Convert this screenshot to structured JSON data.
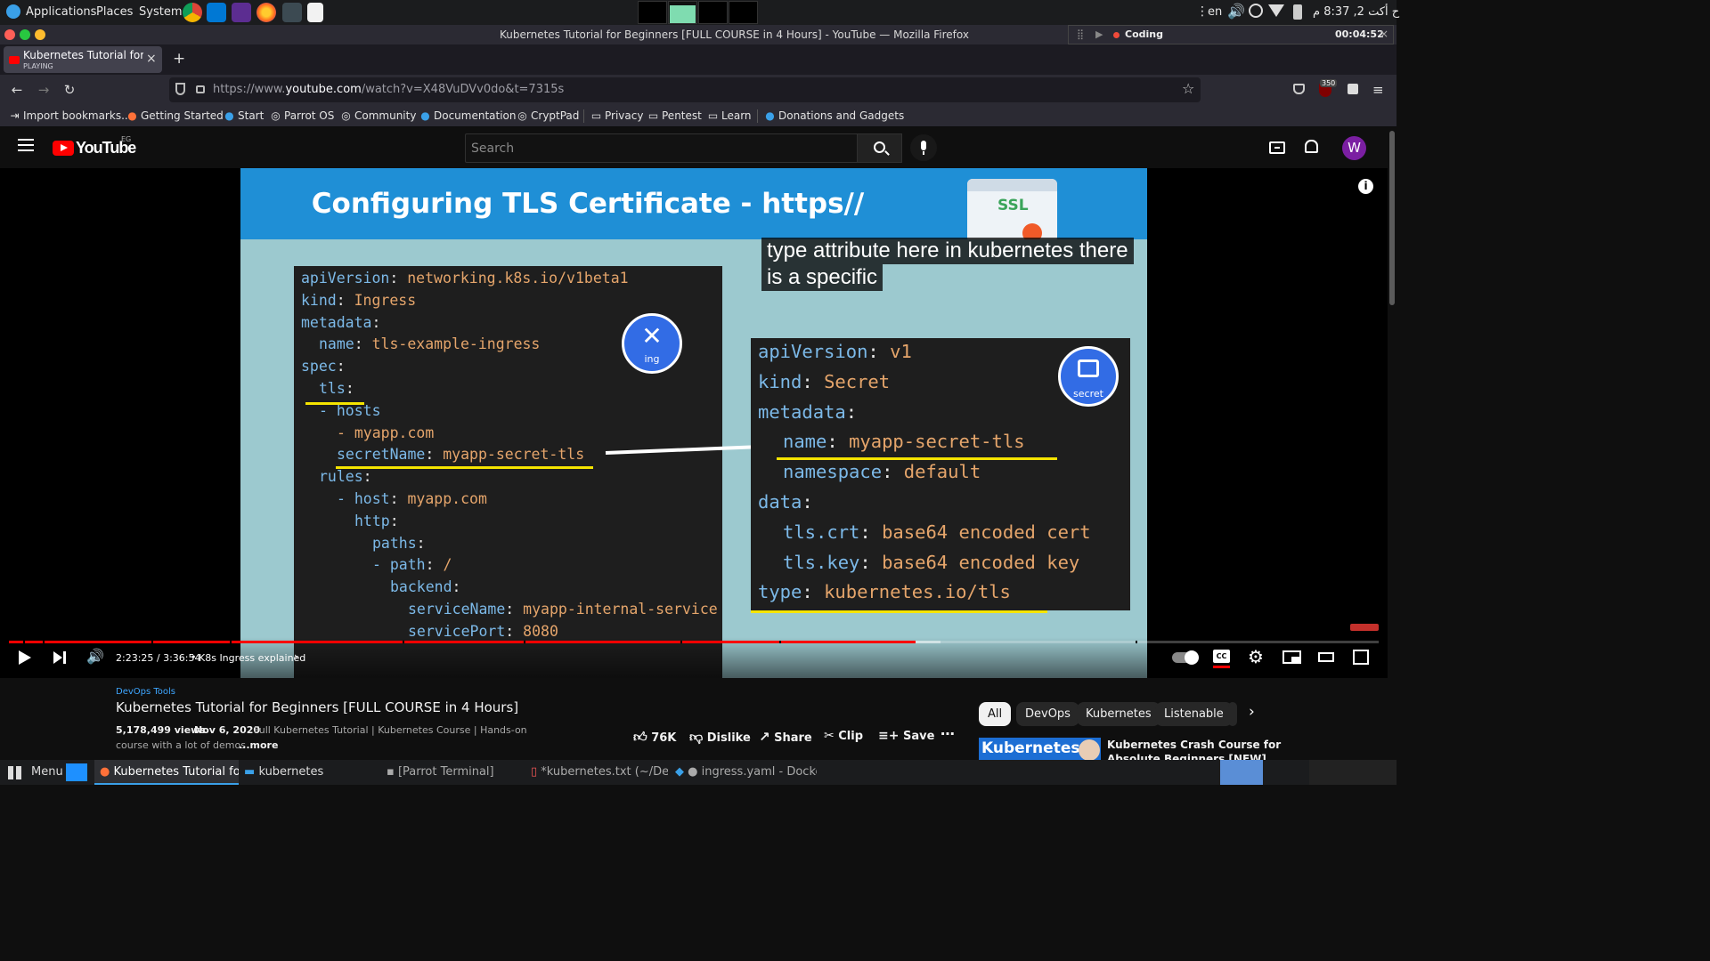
{
  "os_top": {
    "menus": [
      "Applications",
      "Places",
      "System"
    ],
    "keyboard_layout": "en",
    "clock": "ح أكت 2, 8:37 م"
  },
  "window": {
    "title": "Kubernetes Tutorial for Beginners [FULL COURSE in 4 Hours] - YouTube — Mozilla Firefox"
  },
  "media_widget": {
    "label": "Coding",
    "time": "00:04:52"
  },
  "tab": {
    "title": "Kubernetes Tutorial for B",
    "status": "PLAYING",
    "new_tab": "+"
  },
  "urlbar": {
    "prefix": "https://www.",
    "domain": "youtube.com",
    "path": "/watch?v=X48VuDVv0do&t=7315s"
  },
  "extensions": {
    "badge_count": "350"
  },
  "bookmarks": [
    {
      "label": "Import bookmarks...",
      "icon": "import-icon"
    },
    {
      "label": "Getting Started",
      "icon": "firefox-icon"
    },
    {
      "label": "Start",
      "icon": "parrot-icon"
    },
    {
      "label": "Parrot OS",
      "icon": "globe-icon"
    },
    {
      "label": "Community",
      "icon": "globe-icon"
    },
    {
      "label": "Documentation",
      "icon": "parrot-icon"
    },
    {
      "label": "CryptPad",
      "icon": "globe-icon"
    },
    {
      "label": "Privacy",
      "icon": "folder-icon"
    },
    {
      "label": "Pentest",
      "icon": "folder-icon"
    },
    {
      "label": "Learn",
      "icon": "folder-icon"
    },
    {
      "label": "Donations and Gadgets",
      "icon": "parrot-icon"
    }
  ],
  "youtube": {
    "logo_text": "YouTube",
    "region": "EG",
    "search_placeholder": "Search",
    "avatar_letter": "W"
  },
  "slide": {
    "title": "Configuring TLS Certificate - https//",
    "ssl_label": "SSL",
    "ing_label": "ing",
    "secret_label": "secret",
    "ingress_code": [
      {
        "k": "apiVersion",
        "v": "networking.k8s.io/v1beta1",
        "indent": 0
      },
      {
        "k": "kind",
        "v": "Ingress",
        "indent": 0
      },
      {
        "k": "metadata",
        "v": "",
        "indent": 0
      },
      {
        "k": "name",
        "v": "tls-example-ingress",
        "indent": 1
      },
      {
        "k": "spec",
        "v": "",
        "indent": 0
      },
      {
        "k": "tls",
        "v": "",
        "indent": 1
      },
      {
        "k": "- hosts",
        "v": "",
        "indent": 1
      },
      {
        "k": "",
        "v": "- myapp.com",
        "indent": 2
      },
      {
        "k": "secretName",
        "v": "myapp-secret-tls",
        "indent": 2
      },
      {
        "k": "rules",
        "v": "",
        "indent": 1
      },
      {
        "k": "- host",
        "v": "myapp.com",
        "indent": 2
      },
      {
        "k": "http",
        "v": "",
        "indent": 3
      },
      {
        "k": "paths",
        "v": "",
        "indent": 4
      },
      {
        "k": "- path",
        "v": "/",
        "indent": 4
      },
      {
        "k": "backend",
        "v": "",
        "indent": 5
      },
      {
        "k": "serviceName",
        "v": "myapp-internal-service",
        "indent": 6
      },
      {
        "k": "servicePort",
        "v": "8080",
        "indent": 6
      }
    ],
    "secret_code": [
      {
        "k": "apiVersion",
        "v": "v1",
        "indent": 0
      },
      {
        "k": "kind",
        "v": "Secret",
        "indent": 0
      },
      {
        "k": "metadata",
        "v": "",
        "indent": 0
      },
      {
        "k": "name",
        "v": "myapp-secret-tls",
        "indent": 1
      },
      {
        "k": "namespace",
        "v": "default",
        "indent": 1
      },
      {
        "k": "data",
        "v": "",
        "indent": 0
      },
      {
        "k": "tls.crt",
        "v": "base64 encoded cert",
        "indent": 1
      },
      {
        "k": "tls.key",
        "v": "base64 encoded key",
        "indent": 1
      },
      {
        "k": "type",
        "v": "kubernetes.io/tls",
        "indent": 0
      }
    ]
  },
  "captions": [
    "type attribute here in kubernetes there",
    "is a specific"
  ],
  "player": {
    "time": "2:23:25 / 3:36:54",
    "chapter": "K8s Ingress explained",
    "progress": 0.662
  },
  "video": {
    "channel": "DevOps Tools",
    "title": "Kubernetes Tutorial for Beginners [FULL COURSE in 4 Hours]",
    "views": "5,178,499 views",
    "date": "Nov 6, 2020",
    "desc_line1": "Full Kubernetes Tutorial | Kubernetes Course | Hands-on",
    "desc_line2": "course with a lot of demos",
    "more": "...more",
    "likes": "76K",
    "dislike": "Dislike",
    "share": "Share",
    "clip": "Clip",
    "save": "Save"
  },
  "chips": [
    "All",
    "DevOps",
    "Kubernetes",
    "Listenable"
  ],
  "related": {
    "thumb_text": "Kubernetes",
    "title_line1": "Kubernetes Crash Course for",
    "title_line2": "Absolute Beginners [NEW]"
  },
  "taskbar": {
    "menu": "Menu",
    "items": [
      "Kubernetes Tutorial for ...",
      "kubernetes",
      "[Parrot Terminal]",
      "*kubernetes.txt (~/Desk...",
      "● ingress.yaml - Docker..."
    ]
  },
  "colors": {
    "yt_red": "#ff0000",
    "slide_banner": "#1f8fd6",
    "slide_bg": "#9cc9cf",
    "code_key": "#7cb9e8",
    "code_value": "#e5a56b",
    "highlight": "#f5e400",
    "avatar": "#7b1fa2"
  }
}
